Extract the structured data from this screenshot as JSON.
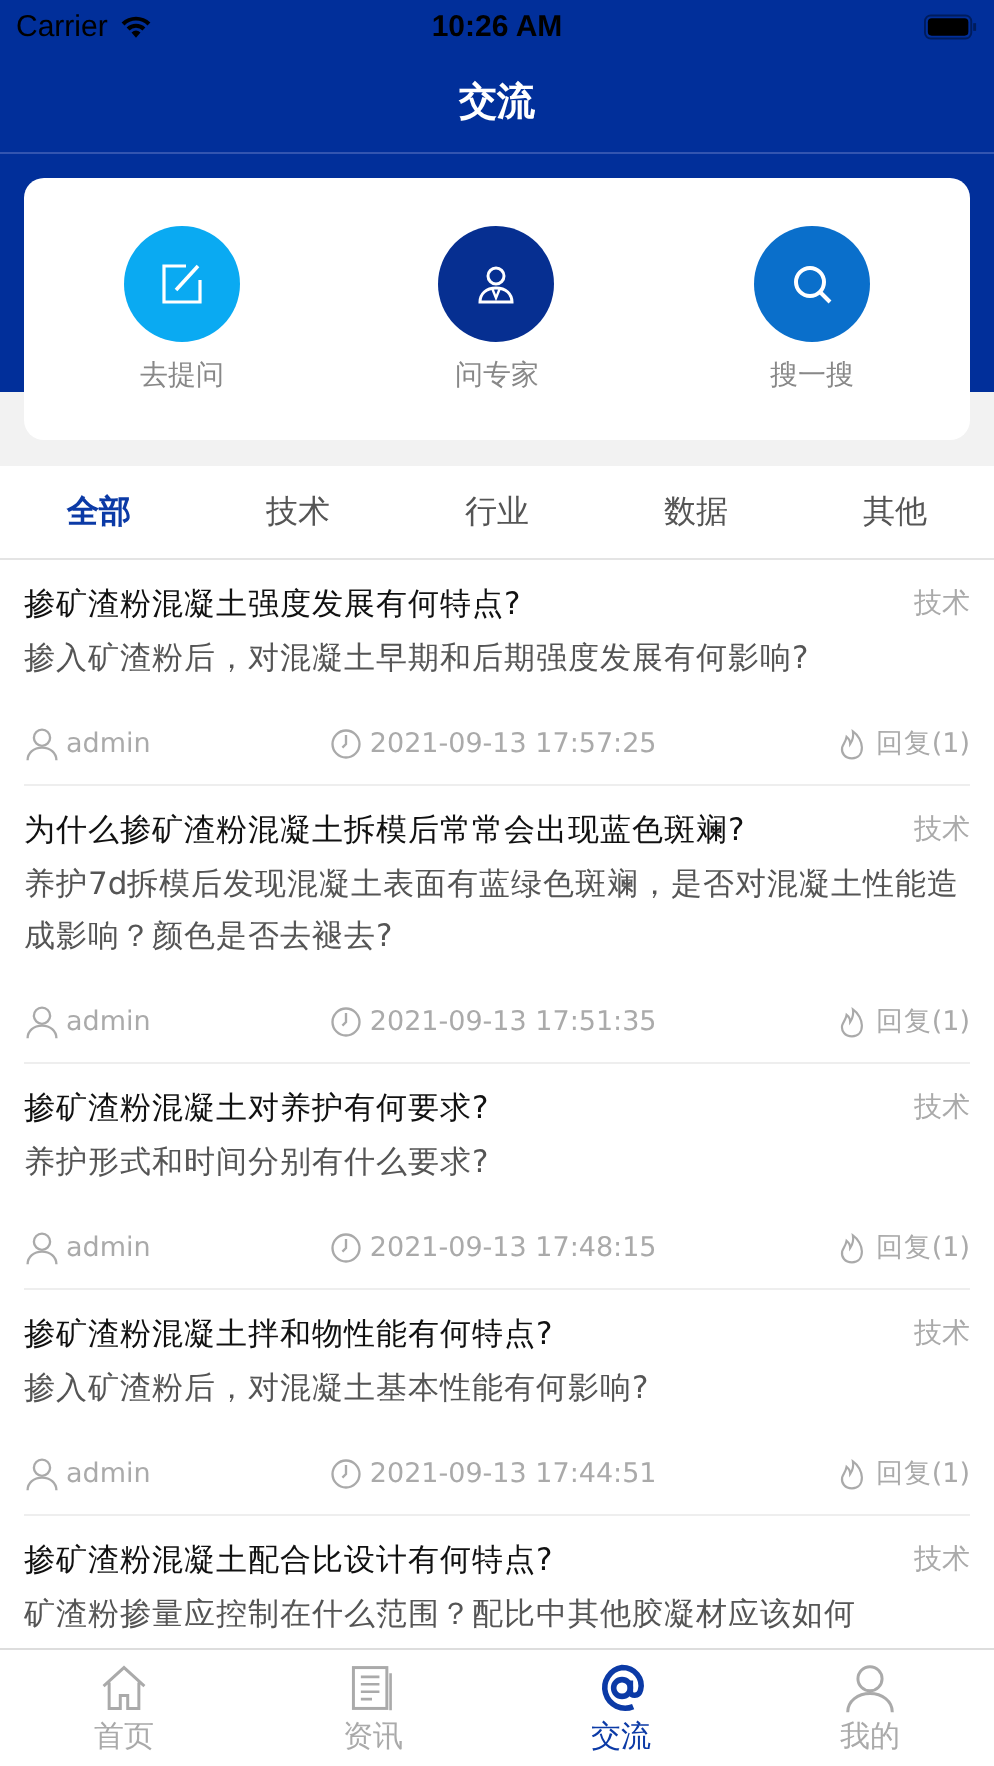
{
  "status_bar": {
    "carrier": "Carrier",
    "time": "10:26 AM"
  },
  "title": "交流",
  "actions": [
    {
      "kind": "ask",
      "label": "去提问",
      "color": "#0aaaf2"
    },
    {
      "kind": "expert",
      "label": "问专家",
      "color": "#062f91"
    },
    {
      "kind": "search",
      "label": "搜一搜",
      "color": "#0a6fcb"
    }
  ],
  "tabs": [
    {
      "label": "全部",
      "selected": true
    },
    {
      "label": "技术",
      "selected": false
    },
    {
      "label": "行业",
      "selected": false
    },
    {
      "label": "数据",
      "selected": false
    },
    {
      "label": "其他",
      "selected": false
    }
  ],
  "posts": [
    {
      "title": "掺矿渣粉混凝土强度发展有何特点?",
      "tag": "技术",
      "body": "掺入矿渣粉后，对混凝土早期和后期强度发展有何影响?",
      "author": "admin",
      "time": "2021-09-13 17:57:25",
      "replies": "回复(1)"
    },
    {
      "title": "为什么掺矿渣粉混凝土拆模后常常会出现蓝色斑斓?",
      "tag": "技术",
      "body": "养护7d拆模后发现混凝土表面有蓝绿色斑斓，是否对混凝土性能造成影响？颜色是否去褪去?",
      "author": "admin",
      "time": "2021-09-13 17:51:35",
      "replies": "回复(1)"
    },
    {
      "title": "掺矿渣粉混凝土对养护有何要求?",
      "tag": "技术",
      "body": "养护形式和时间分别有什么要求?",
      "author": "admin",
      "time": "2021-09-13 17:48:15",
      "replies": "回复(1)"
    },
    {
      "title": "掺矿渣粉混凝土拌和物性能有何特点?",
      "tag": "技术",
      "body": "掺入矿渣粉后，对混凝土基本性能有何影响?",
      "author": "admin",
      "time": "2021-09-13 17:44:51",
      "replies": "回复(1)"
    },
    {
      "title": "掺矿渣粉混凝土配合比设计有何特点?",
      "tag": "技术",
      "body": "矿渣粉掺量应控制在什么范围？配比中其他胶凝材应该如何"
    }
  ],
  "nav": [
    {
      "kind": "home",
      "label": "首页",
      "selected": false
    },
    {
      "kind": "news",
      "label": "资讯",
      "selected": false
    },
    {
      "kind": "at",
      "label": "交流",
      "selected": true
    },
    {
      "kind": "me",
      "label": "我的",
      "selected": false
    }
  ]
}
